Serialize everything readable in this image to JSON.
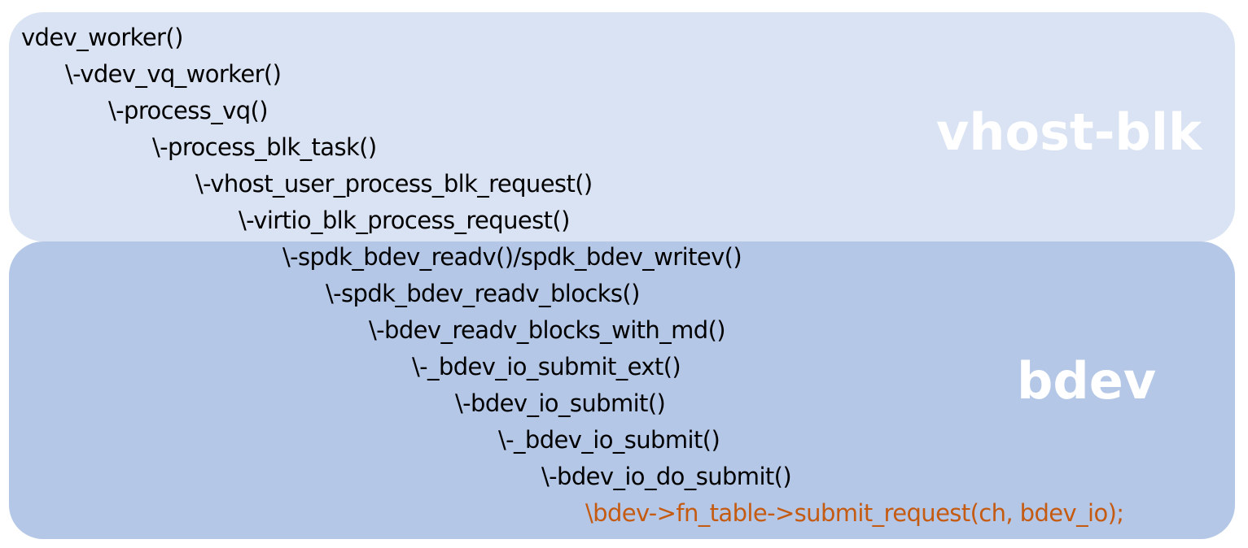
{
  "regions": {
    "top": {
      "label": "vhost-blk",
      "color": "#dae3f3"
    },
    "bottom": {
      "label": "bdev",
      "color": "#b4c7e7"
    }
  },
  "call_chain": [
    {
      "text": "vdev_worker()"
    },
    {
      "text": "\\-vdev_vq_worker()"
    },
    {
      "text": "\\-process_vq()"
    },
    {
      "text": "\\-process_blk_task()"
    },
    {
      "text": "\\-vhost_user_process_blk_request()"
    },
    {
      "text": "\\-virtio_blk_process_request()"
    },
    {
      "text": "\\-spdk_bdev_readv()/spdk_bdev_writev()"
    },
    {
      "text": "\\-spdk_bdev_readv_blocks()"
    },
    {
      "text": "\\-bdev_readv_blocks_with_md()"
    },
    {
      "text": "\\-_bdev_io_submit_ext()"
    },
    {
      "text": "\\-bdev_io_submit()"
    },
    {
      "text": "\\-_bdev_io_submit()"
    },
    {
      "text": "\\-bdev_io_do_submit()"
    },
    {
      "text": "\\bdev->fn_table->submit_request(ch, bdev_io);",
      "highlight_color": "#c55a11"
    }
  ]
}
